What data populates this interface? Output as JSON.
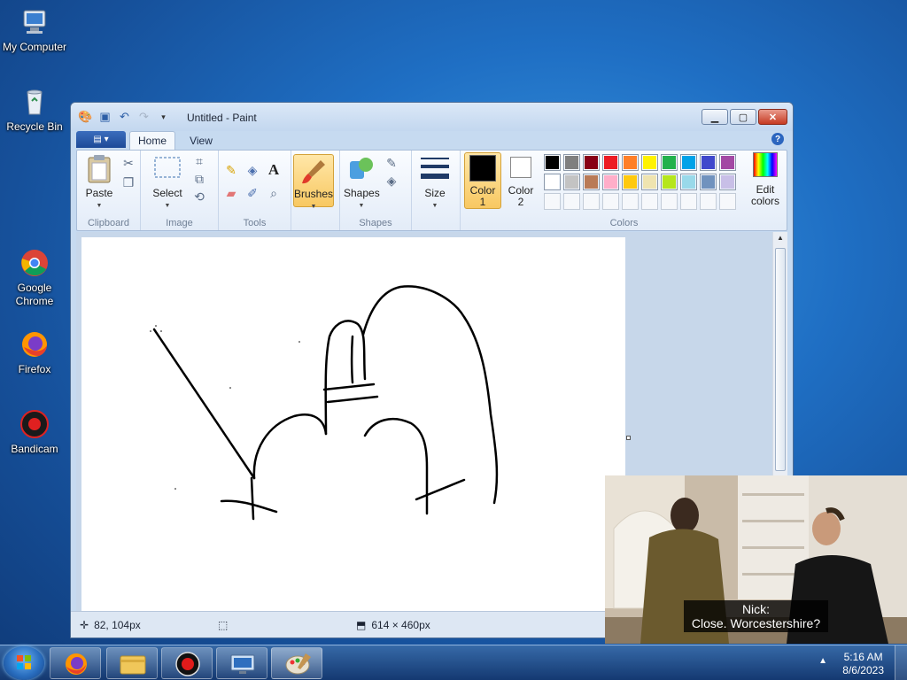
{
  "desktop": {
    "icons": [
      {
        "label": "My Computer",
        "icon": "computer-icon"
      },
      {
        "label": "Recycle Bin",
        "icon": "recycle-bin-icon"
      },
      {
        "label": "Google Chrome",
        "icon": "chrome-icon"
      },
      {
        "label": "Firefox",
        "icon": "firefox-icon"
      },
      {
        "label": "Bandicam",
        "icon": "bandicam-icon"
      }
    ]
  },
  "window": {
    "title": "Untitled - Paint",
    "tabs": {
      "home": "Home",
      "view": "View"
    },
    "help": "?"
  },
  "ribbon": {
    "clipboard": {
      "label": "Clipboard",
      "paste": "Paste"
    },
    "image": {
      "label": "Image",
      "select": "Select"
    },
    "tools": {
      "label": "Tools",
      "text_glyph": "A"
    },
    "brushes": "Brushes",
    "shapes": {
      "label": "Shapes",
      "button": "Shapes"
    },
    "size": "Size",
    "color1": {
      "line1": "Color",
      "line2": "1"
    },
    "color2": {
      "line1": "Color",
      "line2": "2"
    },
    "colors_label": "Colors",
    "edit_colors": {
      "line1": "Edit",
      "line2": "colors"
    },
    "palette_row1": [
      "#000000",
      "#7f7f7f",
      "#880015",
      "#ed1c24",
      "#ff7f27",
      "#fff200",
      "#22b14c",
      "#00a2e8",
      "#3f48cc",
      "#a349a4"
    ],
    "palette_row2": [
      "#ffffff",
      "#c3c3c3",
      "#b97a57",
      "#ffaec9",
      "#ffc90e",
      "#efe4b0",
      "#b5e61d",
      "#99d9ea",
      "#7092be",
      "#c8bfe7"
    ],
    "color1_value": "#000000",
    "color2_value": "#ffffff"
  },
  "status": {
    "cursor_pos": "82, 104px",
    "canvas_size": "614 × 460px"
  },
  "video": {
    "speaker": "Nick:",
    "line": "Close. Worcestershire?"
  },
  "taskbar": {
    "time": "5:16 AM",
    "date": "8/6/2023",
    "apps": [
      "firefox-icon",
      "file-explorer-icon",
      "bandicam-record-icon",
      "remote-desktop-icon",
      "paint-icon"
    ]
  }
}
